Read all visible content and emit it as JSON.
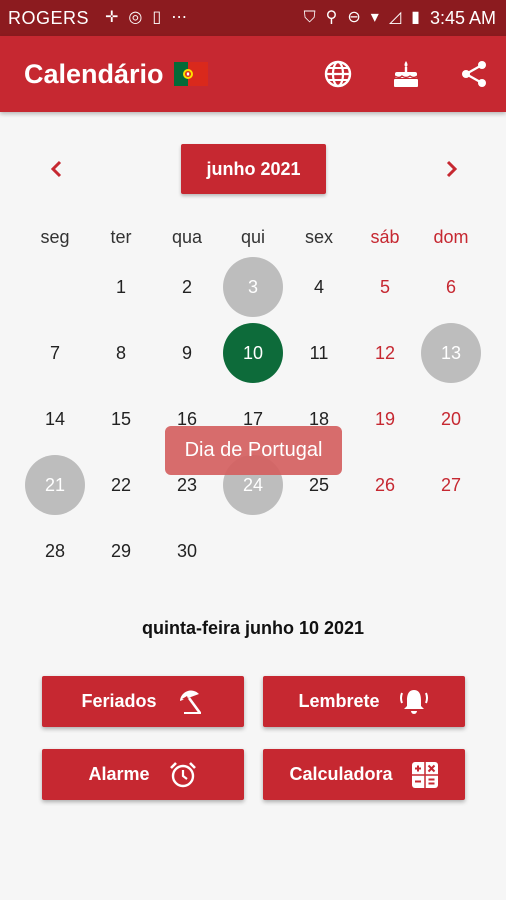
{
  "status_bar": {
    "carrier": "ROGERS",
    "time": "3:45 AM",
    "icons": [
      "signal-extra-icon",
      "sync-icon",
      "phone-icon",
      "more-icon",
      "shield-icon",
      "location-icon",
      "dnd-icon",
      "wifi-icon",
      "no-signal-icon",
      "battery-icon"
    ]
  },
  "app_bar": {
    "title": "Calendário",
    "flag": "portugal-flag",
    "actions": [
      "globe-icon",
      "cake-icon",
      "share-icon"
    ]
  },
  "calendar": {
    "month_label": "junho 2021",
    "prev_icon": "chevron-left-icon",
    "next_icon": "chevron-right-icon",
    "weekdays": [
      "seg",
      "ter",
      "qua",
      "qui",
      "sex",
      "sáb",
      "dom"
    ],
    "leading_blanks": 1,
    "days": [
      "1",
      "2",
      "3",
      "4",
      "5",
      "6",
      "7",
      "8",
      "9",
      "10",
      "11",
      "12",
      "13",
      "14",
      "15",
      "16",
      "17",
      "18",
      "19",
      "20",
      "21",
      "22",
      "23",
      "24",
      "25",
      "26",
      "27",
      "28",
      "29",
      "30"
    ],
    "holidays": [
      3,
      13,
      21,
      24
    ],
    "selected_day": 10,
    "tooltip": "Dia de Portugal"
  },
  "selected_date_text": "quinta-feira junho 10 2021",
  "buttons": {
    "feriados": "Feriados",
    "lembrete": "Lembrete",
    "alarme": "Alarme",
    "calculadora": "Calculadora"
  },
  "colors": {
    "primary": "#c62831",
    "status_bar": "#8c1b1f",
    "selected": "#0d6b3a",
    "holiday": "#bdbdbd",
    "tooltip": "#d46060"
  }
}
